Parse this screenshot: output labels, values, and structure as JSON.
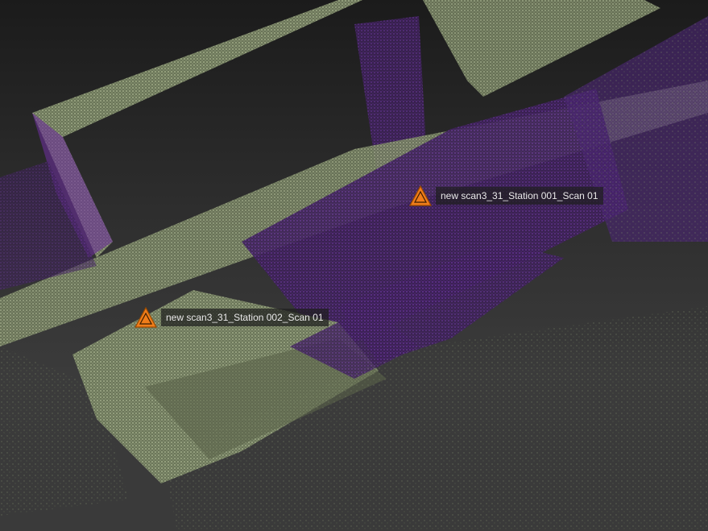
{
  "viewer": {
    "background_top": "#1b1b1b",
    "background_bottom": "#3a3a3a",
    "point_colors": {
      "facade": "#8e9a78",
      "interior": "#5a2d86"
    },
    "markers": [
      {
        "icon": "scan-station-icon",
        "label": "new scan3_31_Station 001_Scan 01",
        "color": "#f07d1a"
      },
      {
        "icon": "scan-station-icon",
        "label": "new scan3_31_Station 002_Scan 01",
        "color": "#f07d1a"
      }
    ]
  }
}
